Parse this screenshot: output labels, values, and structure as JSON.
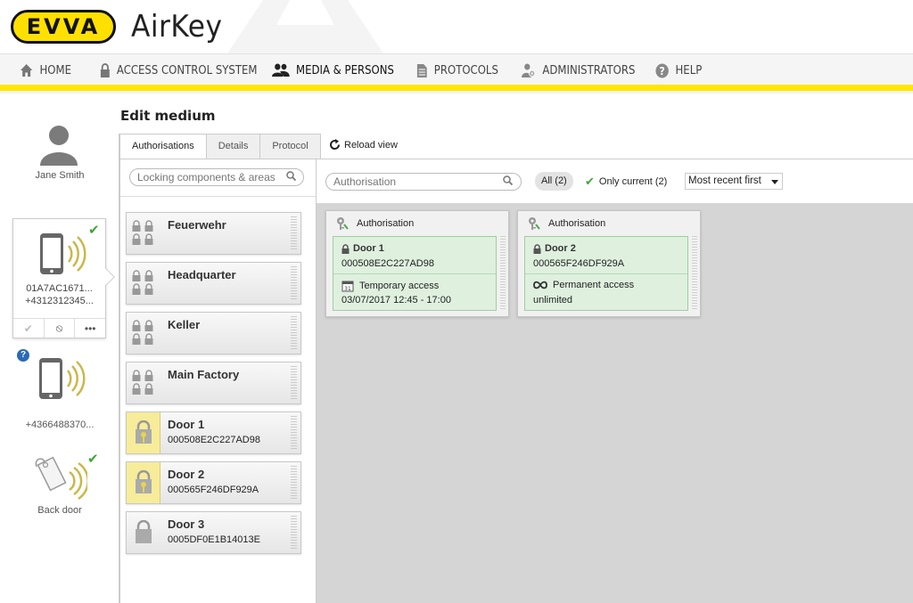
{
  "header": {
    "logo_text": "EVVA",
    "app_title": "AirKey"
  },
  "nav": {
    "items": [
      {
        "label": "Home",
        "icon": "home-icon"
      },
      {
        "label": "Access control system",
        "icon": "lock-icon"
      },
      {
        "label": "Media & persons",
        "icon": "persons-icon",
        "active": true
      },
      {
        "label": "Protocols",
        "icon": "document-icon"
      },
      {
        "label": "Administrators",
        "icon": "admin-gear-icon"
      },
      {
        "label": "Help",
        "icon": "help-icon"
      }
    ],
    "accent_color": "#ffe600"
  },
  "person": {
    "name": "Jane Smith",
    "media": [
      {
        "type": "phone",
        "id": "01A7AC1671...",
        "phone": "+4312312345...",
        "status": "active"
      },
      {
        "type": "phone",
        "id": "",
        "phone": "+4366488370...",
        "status": "unknown"
      },
      {
        "type": "tag",
        "label": "Back door",
        "status": "active"
      }
    ],
    "media_actions": [
      "✔",
      "⦸",
      "•••"
    ]
  },
  "page": {
    "title": "Edit medium",
    "tabs": [
      "Authorisations",
      "Details",
      "Protocol"
    ],
    "active_tab": "Authorisations",
    "reload_label": "Reload view"
  },
  "locking_list": {
    "search_placeholder": "Locking components & areas",
    "items": [
      {
        "name": "Feuerwehr",
        "type": "area"
      },
      {
        "name": "Headquarter",
        "type": "area"
      },
      {
        "name": "Keller",
        "type": "area"
      },
      {
        "name": "Main Factory",
        "type": "area"
      },
      {
        "name": "Door 1",
        "serial": "000508E2C227AD98",
        "type": "door-authorised"
      },
      {
        "name": "Door 2",
        "serial": "000565F246DF929A",
        "type": "door-authorised"
      },
      {
        "name": "Door 3",
        "serial": "0005DF0E1B14013E",
        "type": "door"
      }
    ]
  },
  "filters": {
    "search_placeholder": "Authorisation",
    "all_label": "All (2)",
    "only_current_label": "Only current (2)",
    "sort_value": "Most recent first"
  },
  "authorisations": [
    {
      "header": "Authorisation",
      "door": "Door 1",
      "serial": "000508E2C227AD98",
      "access_type": "Temporary access",
      "access_icon": "calendar-icon",
      "time": "03/07/2017 12:45 - 17:00"
    },
    {
      "header": "Authorisation",
      "door": "Door 2",
      "serial": "000565F246DF929A",
      "access_type": "Permanent access",
      "access_icon": "infinity-icon",
      "time": "unlimited"
    }
  ]
}
